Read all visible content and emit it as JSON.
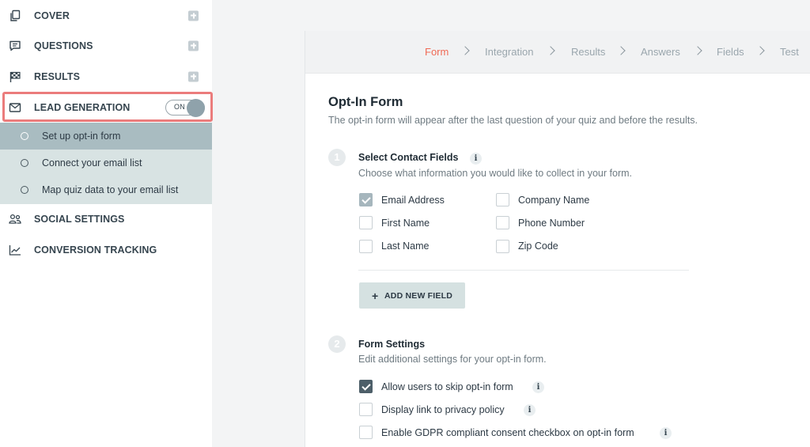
{
  "sidebar": {
    "items": [
      {
        "label": "COVER",
        "icon": "copy-icon"
      },
      {
        "label": "QUESTIONS",
        "icon": "chat-bubble-icon"
      },
      {
        "label": "RESULTS",
        "icon": "checkered-flag-icon"
      },
      {
        "label": "LEAD GENERATION",
        "icon": "envelope-icon"
      },
      {
        "label": "SOCIAL SETTINGS",
        "icon": "people-icon"
      },
      {
        "label": "CONVERSION TRACKING",
        "icon": "trend-chart-icon"
      }
    ],
    "lead_toggle": {
      "label": "ON",
      "state": "on"
    },
    "lead_sub_items": [
      {
        "label": "Set up opt-in form",
        "active": true
      },
      {
        "label": "Connect your email list",
        "active": false
      },
      {
        "label": "Map quiz data to your email list",
        "active": false
      }
    ],
    "highlight_color": "#eb7c7c"
  },
  "steps": [
    {
      "label": "Form",
      "active": true
    },
    {
      "label": "Integration",
      "active": false
    },
    {
      "label": "Results",
      "active": false
    },
    {
      "label": "Answers",
      "active": false
    },
    {
      "label": "Fields",
      "active": false
    },
    {
      "label": "Test",
      "active": false
    }
  ],
  "form": {
    "title": "Opt-In Form",
    "description": "The opt-in form will appear after the last question of your quiz and before the results."
  },
  "contact_fields": {
    "number": "1",
    "title": "Select Contact Fields",
    "description": "Choose what information you would like to collect in your form.",
    "fields": [
      {
        "label": "Email Address",
        "checked": true
      },
      {
        "label": "Company Name",
        "checked": false
      },
      {
        "label": "First Name",
        "checked": false
      },
      {
        "label": "Phone Number",
        "checked": false
      },
      {
        "label": "Last Name",
        "checked": false
      },
      {
        "label": "Zip Code",
        "checked": false
      }
    ],
    "add_button": "ADD NEW FIELD"
  },
  "form_settings": {
    "number": "2",
    "title": "Form Settings",
    "description": "Edit additional settings for your opt-in form.",
    "options": [
      {
        "label": "Allow users to skip opt-in form",
        "checked": true
      },
      {
        "label": "Display link to privacy policy",
        "checked": false
      },
      {
        "label": "Enable GDPR compliant consent checkbox on opt-in form",
        "checked": false
      }
    ]
  },
  "colors": {
    "accent": "#ef6a55",
    "sidebar_sub_bg": "#d8e3e3",
    "sidebar_active_bg": "#a9bcc1"
  }
}
